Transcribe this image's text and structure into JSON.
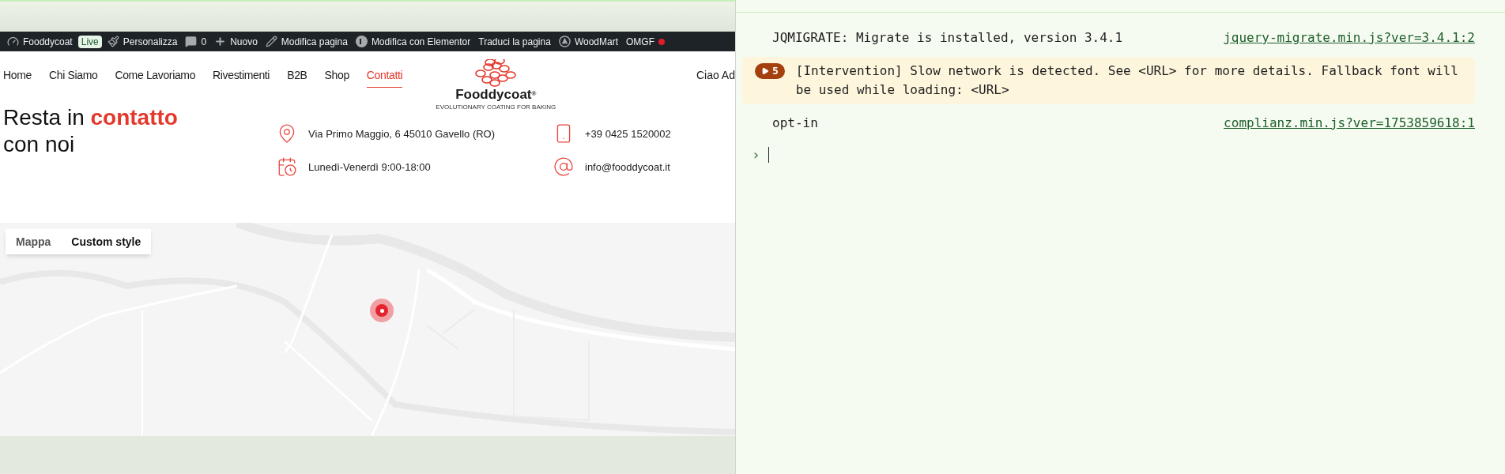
{
  "admin_bar": {
    "items": [
      {
        "label": "Fooddycoat",
        "kind": "gauge"
      },
      {
        "label": "Live",
        "kind": "badge"
      },
      {
        "label": "Personalizza",
        "kind": "brush"
      },
      {
        "label": "0",
        "kind": "comment"
      },
      {
        "label": "Nuovo",
        "kind": "plus"
      },
      {
        "label": "Modifica pagina",
        "kind": "pencil"
      },
      {
        "label": "Modifica con Elementor",
        "kind": "elementor"
      },
      {
        "label": "Traduci la pagina",
        "kind": "text"
      },
      {
        "label": "WoodMart",
        "kind": "woodmart"
      },
      {
        "label": "OMGF",
        "kind": "dot"
      }
    ]
  },
  "nav": {
    "items": [
      {
        "label": "Home",
        "selected": false
      },
      {
        "label": "Chi Siamo",
        "selected": false
      },
      {
        "label": "Come Lavoriamo",
        "selected": false
      },
      {
        "label": "Rivestimenti",
        "selected": false
      },
      {
        "label": "B2B",
        "selected": false
      },
      {
        "label": "Shop",
        "selected": false
      },
      {
        "label": "Contatti",
        "selected": true
      }
    ],
    "logo": {
      "name": "Fooddycoat",
      "mark": "®",
      "tagline": "EVOLUTIONARY COATING FOR BAKING"
    },
    "greeting": "Ciao Ad"
  },
  "contact": {
    "heading": {
      "lead": "Resta in",
      "accent": "contatto",
      "line2": "con noi"
    },
    "items": [
      {
        "kind": "address",
        "text": "Via Primo Maggio, 6 45010 Gavello (RO)"
      },
      {
        "kind": "phone",
        "text": "+39 0425 1520002"
      },
      {
        "kind": "hours",
        "text": "Lunedì-Venerdì 9:00-18:00"
      },
      {
        "kind": "email",
        "text": "info@fooddycoat.it"
      }
    ]
  },
  "map": {
    "kind": "picture",
    "controls": [
      {
        "label": "Mappa",
        "selected": false
      },
      {
        "label": "Custom style",
        "selected": true
      }
    ]
  },
  "console": {
    "messages": [
      {
        "kind": "log",
        "text": "JQMIGRATE: Migrate is installed, version 3.4.1",
        "source": "jquery-migrate.min.js?ver=3.4.1:2"
      },
      {
        "kind": "intervention",
        "count": "5",
        "text": "[Intervention] Slow network is detected. See <URL> for more details. Fallback font will be used while loading: <URL>"
      },
      {
        "kind": "log",
        "text": "opt-in",
        "source": "complianz.min.js?ver=1753859618:1"
      }
    ],
    "prompt": "›"
  }
}
